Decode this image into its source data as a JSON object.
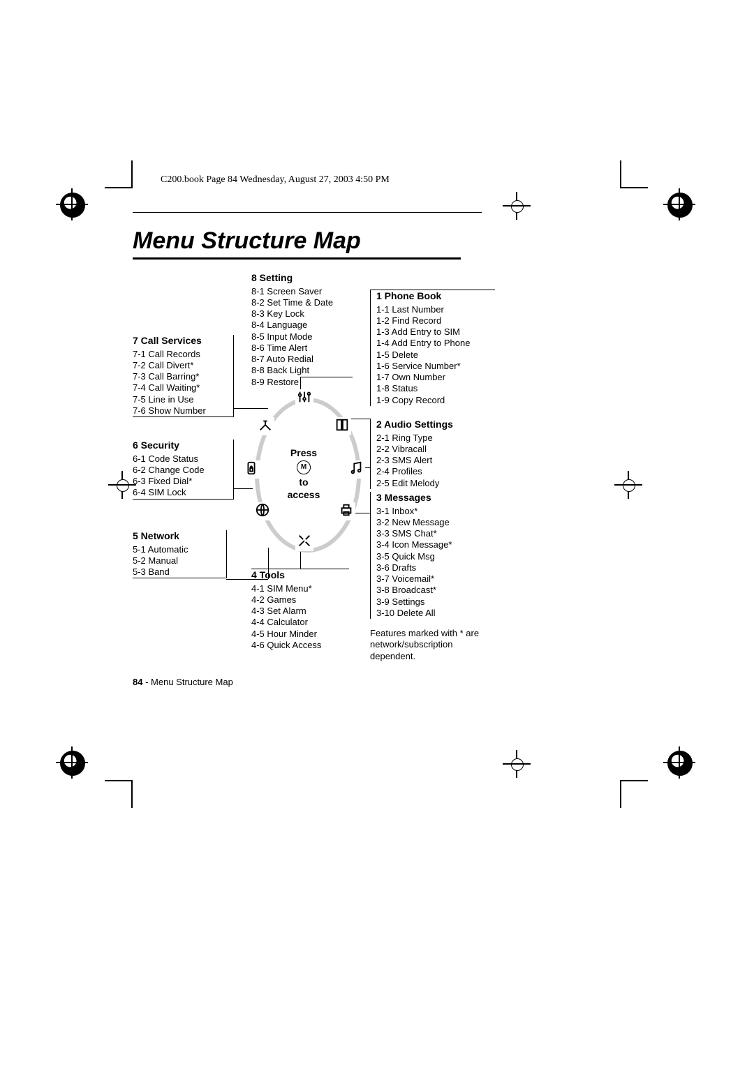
{
  "header": "C200.book  Page 84  Wednesday, August 27, 2003  4:50 PM",
  "title": "Menu Structure Map",
  "center": {
    "press": "Press",
    "to": "to",
    "access": "access",
    "key": "M"
  },
  "menus": {
    "setting": {
      "title": "8 Setting",
      "items": [
        "8-1 Screen Saver",
        "8-2 Set Time & Date",
        "8-3 Key Lock",
        "8-4 Language",
        "8-5 Input Mode",
        "8-6 Time Alert",
        "8-7 Auto Redial",
        "8-8 Back Light",
        "8-9 Restore"
      ]
    },
    "call": {
      "title": "7 Call Services",
      "items": [
        "7-1 Call Records",
        "7-2 Call Divert*",
        "7-3 Call Barring*",
        "7-4 Call Waiting*",
        "7-5 Line in Use",
        "7-6 Show Number"
      ]
    },
    "security": {
      "title": "6 Security",
      "items": [
        "6-1 Code Status",
        "6-2 Change Code",
        "6-3 Fixed Dial*",
        "6-4 SIM Lock"
      ]
    },
    "network": {
      "title": "5 Network",
      "items": [
        "5-1 Automatic",
        "5-2 Manual",
        "5-3 Band"
      ]
    },
    "tools": {
      "title": "4 Tools",
      "items": [
        "4-1 SIM Menu*",
        "4-2 Games",
        "4-3 Set Alarm",
        "4-4 Calculator",
        "4-5 Hour Minder",
        "4-6 Quick Access"
      ]
    },
    "phonebook": {
      "title": "1 Phone Book",
      "items": [
        "1-1 Last Number",
        "1-2 Find Record",
        "1-3 Add Entry to SIM",
        "1-4 Add Entry to Phone",
        "1-5 Delete",
        "1-6 Service Number*",
        "1-7 Own Number",
        "1-8 Status",
        "1-9 Copy Record"
      ]
    },
    "audio": {
      "title": "2 Audio Settings",
      "items": [
        "2-1 Ring Type",
        "2-2 Vibracall",
        "2-3 SMS Alert",
        "2-4 Profiles",
        "2-5 Edit Melody"
      ]
    },
    "messages": {
      "title": "3 Messages",
      "items": [
        "3-1 Inbox*",
        "3-2 New Message",
        "3-3 SMS Chat*",
        "3-4 Icon Message*",
        "3-5 Quick Msg",
        "3-6 Drafts",
        "3-7 Voicemail*",
        "3-8 Broadcast*",
        "3-9 Settings",
        "3-10 Delete All"
      ]
    }
  },
  "note": "Features marked with * are network/subscription dependent.",
  "footer": {
    "page": "84",
    "sep": " - ",
    "label": "Menu Structure Map"
  }
}
